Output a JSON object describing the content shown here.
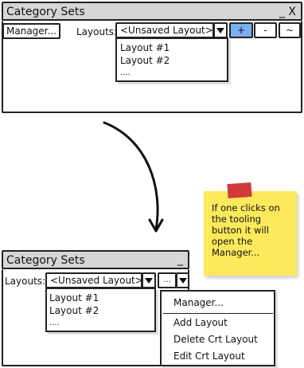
{
  "top_window": {
    "title": "Category Sets",
    "close_label": "_ X",
    "manager_button": "Manager...",
    "layouts_label": "Layouts:",
    "combo_value": "<Unsaved Layout>",
    "plus_button": "+",
    "minus_button": "-",
    "tilde_button": "~",
    "dropdown_items": [
      "Layout #1",
      "Layout #2",
      "...."
    ]
  },
  "bottom_window": {
    "title": "Category Sets",
    "minimize_label": "_",
    "layouts_label": "Layouts:",
    "combo_value": "<Unsaved Layout>",
    "tool_button": "...",
    "dropdown_items": [
      "Layout #1",
      "Layout #2",
      "...."
    ],
    "menu_items": [
      "Manager...",
      "Add Layout",
      "Delete Crt Layout",
      "Edit Crt Layout"
    ]
  },
  "sticky_note": {
    "text": "If one clicks on the tooling button it will open the Manager...",
    "color": "#fde95b",
    "tape_color": "#d23a3a"
  },
  "colors": {
    "titlebar": "#d6d6d6",
    "selected_button": "#7aaef2"
  }
}
